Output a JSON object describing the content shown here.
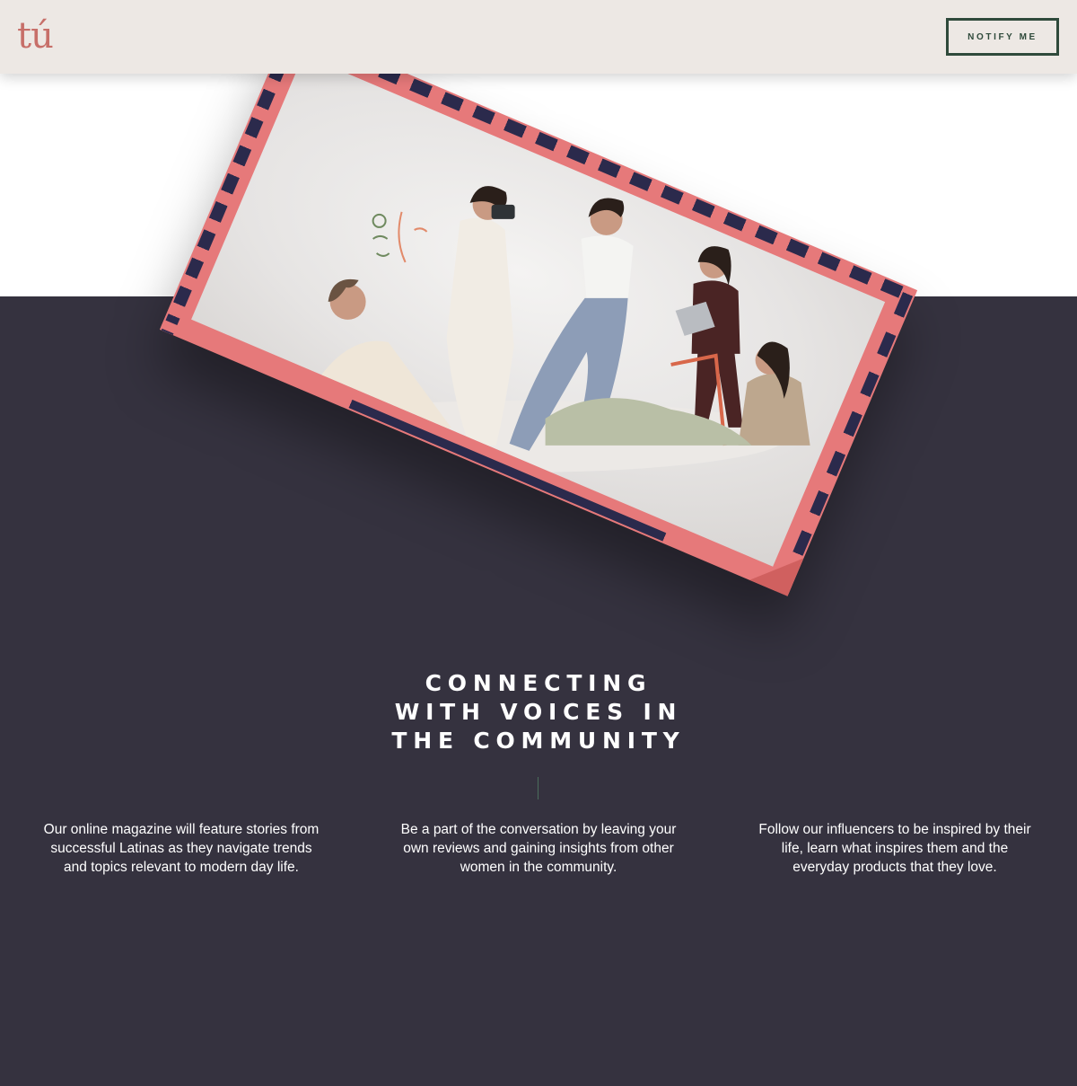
{
  "header": {
    "logo_text": "tú",
    "notify_label": "NOTIFY ME"
  },
  "hero": {
    "image_alt": "Five women posing together in a white studio"
  },
  "section": {
    "headline_lines": [
      "CONNECTING",
      "WITH VOICES IN",
      "THE COMMUNITY"
    ],
    "features": [
      "Our online magazine will feature stories from successful Latinas as they navigate trends and topics relevant to modern day life.",
      "Be a part of the conversation by leaving your own reviews and gaining insights from other women in the community.",
      "Follow our influencers to be inspired by their life, learn what inspires them and the everyday products that they love."
    ]
  },
  "colors": {
    "header_bg": "#ede8e4",
    "brand_coral": "#c76f69",
    "button_green": "#2f4a3b",
    "dark_bg": "#35323f",
    "frame_pink": "#e6797a",
    "frame_navy": "#2b2a4c"
  }
}
